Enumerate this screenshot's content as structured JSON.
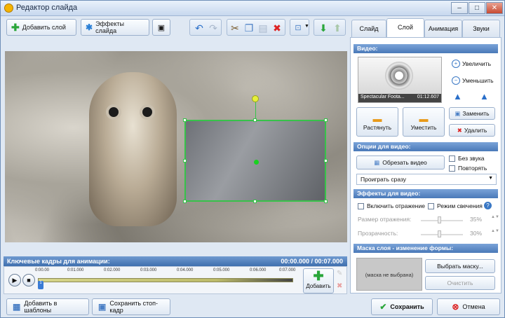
{
  "window": {
    "title": "Редактор слайда"
  },
  "toolbar": {
    "add_layer": "Добавить слой",
    "slide_effects": "Эффекты слайда"
  },
  "keyframes": {
    "title": "Ключевые кадры для анимации:",
    "time": "00:00.000 / 00:07.000",
    "ticks": [
      "0:00.00",
      "0:01.000",
      "0:02.000",
      "0:03.000",
      "0:04.000",
      "0:05.000",
      "0:06.000",
      "0:07.000"
    ],
    "marker": "1",
    "add_label": "Добавить"
  },
  "bottom": {
    "add_template": "Добавить в шаблоны",
    "save_frame": "Сохранить стоп-кадр",
    "save": "Сохранить",
    "cancel": "Отмена"
  },
  "tabs": [
    "Слайд",
    "Слой",
    "Анимация",
    "Звуки"
  ],
  "active_tab": "Слой",
  "video": {
    "header": "Видео:",
    "filename": "Spectacular Foota...",
    "duration": "01:12.607",
    "zoom_in": "Увеличить",
    "zoom_out": "Уменьшить",
    "stretch": "Растянуть",
    "fit": "Уместить",
    "replace": "Заменить",
    "delete": "Удалить"
  },
  "options": {
    "header": "Опции для видео:",
    "trim": "Обрезать видео",
    "mute": "Без звука",
    "repeat": "Повторять",
    "play_mode": "Проиграть сразу"
  },
  "effects": {
    "header": "Эффекты для видео:",
    "reflection": "Включить отражение",
    "glow": "Режим свечения",
    "reflection_size_label": "Размер отражения:",
    "reflection_size_value": "35%",
    "transparency_label": "Прозрачность:",
    "transparency_value": "30%"
  },
  "mask": {
    "header": "Маска слоя - изменение формы:",
    "none": "(маска не выбрана)",
    "choose": "Выбрать маску...",
    "clear": "Очистить"
  }
}
